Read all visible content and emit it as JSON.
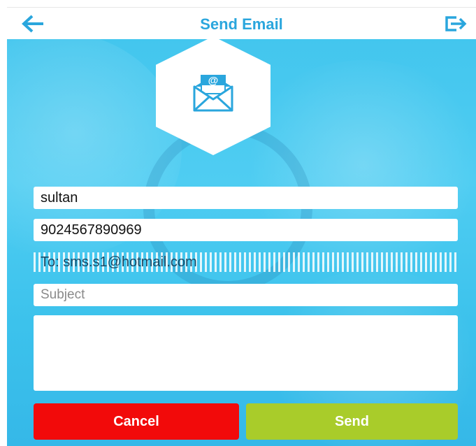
{
  "header": {
    "title": "Send Email",
    "back_icon": "arrow-left-icon",
    "logout_icon": "logout-icon",
    "accent_color": "#2aa6dd"
  },
  "form": {
    "name_value": "sultan",
    "phone_value": "9024567890969",
    "to_text": "To: sms.s1@hotmail.com",
    "subject_placeholder": "Subject",
    "message_value": ""
  },
  "buttons": {
    "cancel_label": "Cancel",
    "send_label": "Send",
    "cancel_color": "#f20a0a",
    "send_color": "#a9cc2a"
  },
  "icons": {
    "header_icon": "email-at-envelope-icon"
  }
}
